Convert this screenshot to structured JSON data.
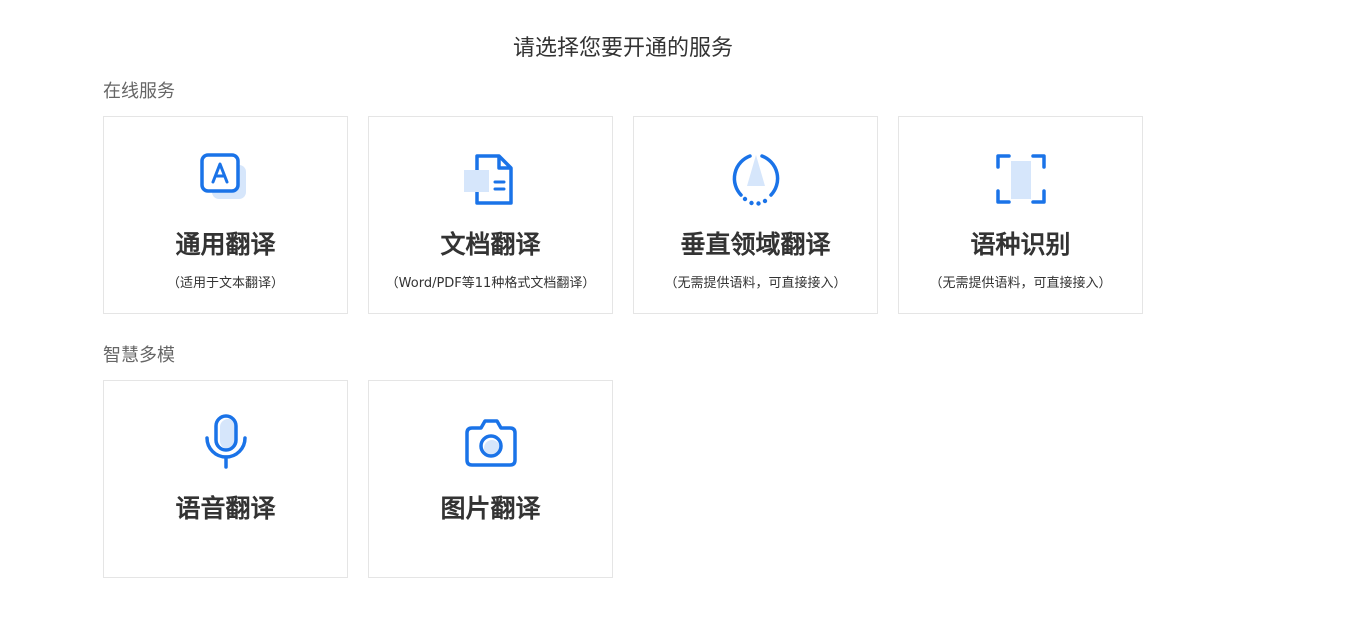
{
  "header": {
    "title": "请选择您要开通的服务"
  },
  "sections": [
    {
      "title": "在线服务",
      "cards": [
        {
          "icon": "text-translate-icon",
          "name": "通用翻译",
          "desc": "（适用于文本翻译）"
        },
        {
          "icon": "document-icon",
          "name": "文档翻译",
          "desc": "（Word/PDF等11种格式文档翻译）"
        },
        {
          "icon": "domain-compass-icon",
          "name": "垂直领域翻译",
          "desc": "（无需提供语料，可直接接入）"
        },
        {
          "icon": "scan-frame-icon",
          "name": "语种识别",
          "desc": "（无需提供语料，可直接接入）"
        }
      ]
    },
    {
      "title": "智慧多模",
      "cards": [
        {
          "icon": "microphone-icon",
          "name": "语音翻译",
          "desc": ""
        },
        {
          "icon": "camera-icon",
          "name": "图片翻译",
          "desc": ""
        }
      ]
    }
  ],
  "colors": {
    "accent": "#1a73e8",
    "accent_light": "#d6e6fb",
    "card_border": "#e5e5e5",
    "text": "#333333",
    "section_text": "#666666"
  }
}
